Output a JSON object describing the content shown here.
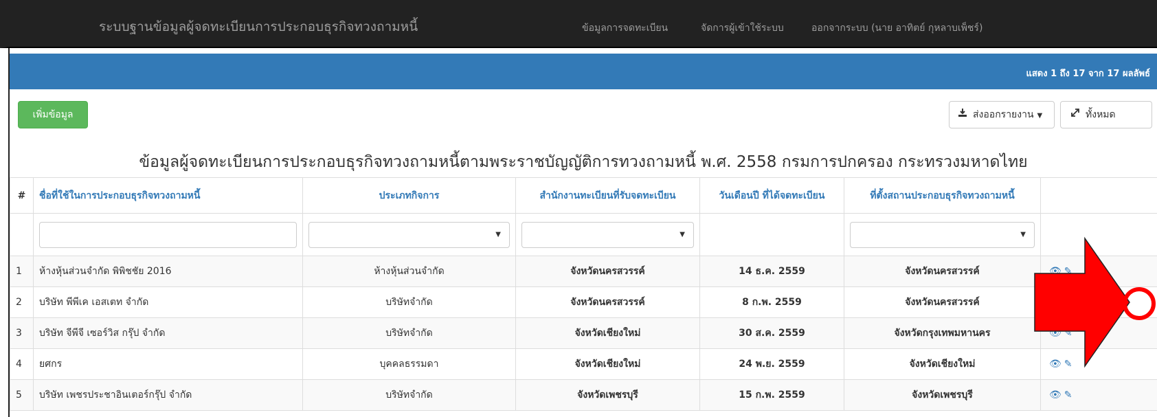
{
  "navbar": {
    "brand": "ระบบฐานข้อมูลผู้จดทะเบียนการประกอบธุรกิจทวงถามหนี้",
    "items": [
      "ข้อมูลการจดทะเบียน",
      "จัดการผู้เข้าใช้ระบบ",
      "ออกจากระบบ (นาย อาทิตย์ กุหลาบเพ็ชร์)"
    ]
  },
  "info_bar": {
    "text": "แสดง 1 ถึง 17 จาก 17 ผลลัพธ์"
  },
  "toolbar": {
    "add_label": "เพิ่มข้อมูล",
    "export_label": "ส่งออกรายงาน",
    "all_label": "ทั้งหมด"
  },
  "page_title": "ข้อมูลผู้จดทะเบียนการประกอบธุรกิจทวงถามหนี้ตามพระราชบัญญัติการทวงถามหนี้ พ.ศ. 2558 กรมการปกครอง กระทรวงมหาดไทย",
  "table": {
    "headers": [
      "#",
      "ชื่อที่ใช้ในการประกอบธุรกิจทวงถามหนี้",
      "ประเภทกิจการ",
      "สำนักงานทะเบียนที่รับจดทะเบียน",
      "วันเดือนปี ที่ได้จดทะเบียน",
      "ที่ตั้งสถานประกอบธุรกิจทวงถามหนี้",
      ""
    ],
    "rows": [
      {
        "num": "1",
        "name": "ห้างหุ้นส่วนจำกัด พิพิชชัย 2016",
        "type": "ห้างหุ้นส่วนจำกัด",
        "office": "จังหวัดนครสวรรค์",
        "date": "14 ธ.ค. 2559",
        "location": "จังหวัดนครสวรรค์"
      },
      {
        "num": "2",
        "name": "บริษัท พีพีเค เอสเตท จำกัด",
        "type": "บริษัทจำกัด",
        "office": "จังหวัดนครสวรรค์",
        "date": "8 ก.พ. 2559",
        "location": "จังหวัดนครสวรรค์"
      },
      {
        "num": "3",
        "name": "บริษัท จีพีจี เซอร์วิส กรุ๊ป จำกัด",
        "type": "บริษัทจำกัด",
        "office": "จังหวัดเชียงใหม่",
        "date": "30 ส.ค. 2559",
        "location": "จังหวัดกรุงเทพมหานคร"
      },
      {
        "num": "4",
        "name": "ยศกร",
        "type": "บุคคลธรรมดา",
        "office": "จังหวัดเชียงใหม่",
        "date": "24 พ.ย. 2559",
        "location": "จังหวัดเชียงใหม่"
      },
      {
        "num": "5",
        "name": "บริษัท เพชรประชาอินเตอร์กรุ๊ป จำกัด",
        "type": "บริษัทจำกัด",
        "office": "จังหวัดเพชรบุรี",
        "date": "15 ก.พ. 2559",
        "location": "จังหวัดเพชรบุรี"
      }
    ]
  },
  "icons": {
    "view": "eye-icon",
    "edit": "pencil-icon",
    "export": "download-icon",
    "all": "expand-icon"
  },
  "colors": {
    "navbar_bg": "#222222",
    "info_bar_bg": "#337ab7",
    "add_button": "#5cb85c",
    "link": "#337ab7",
    "annotation_arrow": "#ff0000"
  }
}
